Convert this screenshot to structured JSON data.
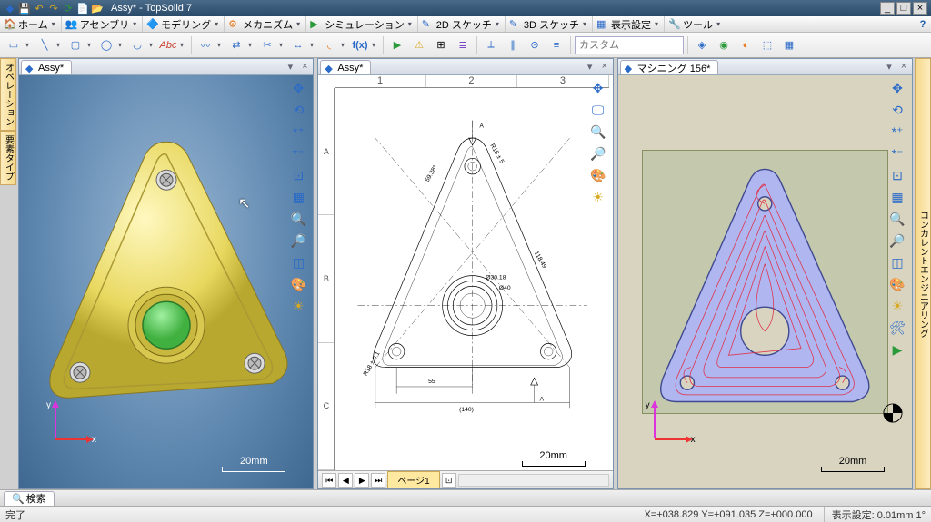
{
  "app": {
    "title": "Assy* - TopSolid 7"
  },
  "menu": {
    "items": [
      {
        "label": "ホーム",
        "icon": "🏠"
      },
      {
        "label": "アセンブリ",
        "icon": "👥"
      },
      {
        "label": "モデリング",
        "icon": "🔷"
      },
      {
        "label": "メカニズム",
        "icon": "⚙"
      },
      {
        "label": "シミュレーション",
        "icon": "📊"
      },
      {
        "label": "2D スケッチ",
        "icon": "✏"
      },
      {
        "label": "3D スケッチ",
        "icon": "✏"
      },
      {
        "label": "表示設定",
        "icon": "👁"
      },
      {
        "label": "ツール",
        "icon": "🔧"
      }
    ],
    "help": "?"
  },
  "toolbar": {
    "search_placeholder": "カスタム"
  },
  "vtabs": {
    "left1": "オペレーション",
    "left2": "要素タイプ",
    "right": "コンカレントエンジニアリング"
  },
  "panes": {
    "p1": {
      "tab": "Assy*",
      "scale": "20mm",
      "axis_x": "x",
      "axis_y": "y"
    },
    "p2": {
      "tab": "Assy*",
      "scale": "20mm",
      "page": "ページ1",
      "ruler_cols": [
        "1",
        "2",
        "3"
      ],
      "ruler_rows": [
        "A",
        "B",
        "C"
      ],
      "dims": {
        "d1": "55",
        "d2": "(140)",
        "r1": "R18 ± 0.1",
        "r2": "R18 ± 5",
        "ang": "59.38°",
        "d3": "Ø30.18",
        "d4": "Ø40",
        "len": "118.49",
        "a": "A"
      }
    },
    "p3": {
      "tab": "マシニング 156*",
      "scale": "20mm",
      "axis_x": "x",
      "axis_y": "y"
    }
  },
  "bottom": {
    "tab": "検索"
  },
  "status": {
    "left": "完了",
    "coords": "X=+038.829   Y=+091.035   Z=+000.000",
    "disp": "表示設定: 0.01mm 1°"
  }
}
